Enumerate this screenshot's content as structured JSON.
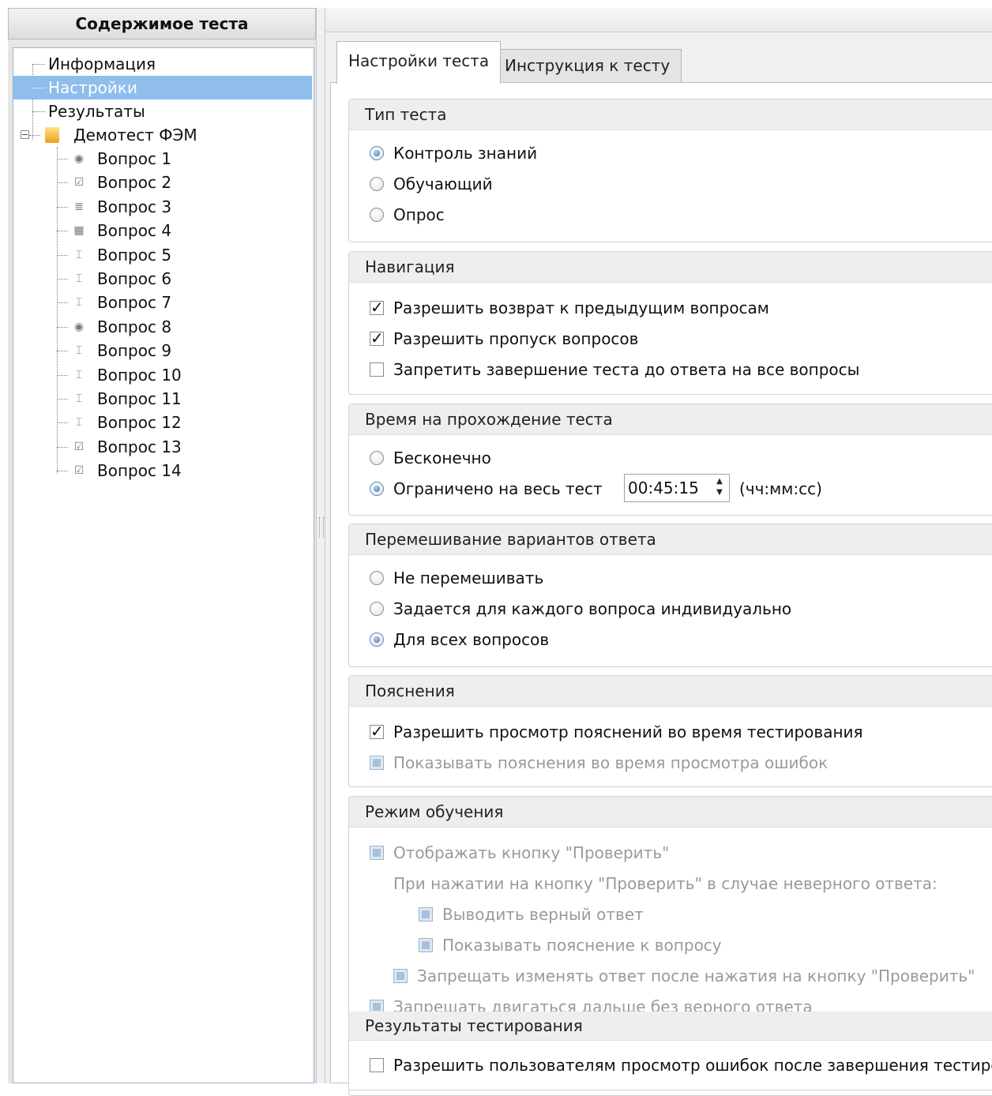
{
  "left_panel": {
    "title": "Содержимое теста",
    "tree": {
      "info": "Информация",
      "settings": "Настройки",
      "results": "Результаты",
      "folder": "Демотест ФЭМ",
      "questions": [
        {
          "label": "Вопрос 1",
          "icon": "radio-question-icon",
          "glyph": "◉"
        },
        {
          "label": "Вопрос 2",
          "icon": "checkbox-question-icon",
          "glyph": "☑"
        },
        {
          "label": "Вопрос 3",
          "icon": "ordering-question-icon",
          "glyph": "≣"
        },
        {
          "label": "Вопрос 4",
          "icon": "matching-question-icon",
          "glyph": "▦"
        },
        {
          "label": "Вопрос 5",
          "icon": "text-input-question-icon",
          "glyph": "⌶"
        },
        {
          "label": "Вопрос 6",
          "icon": "text-input-question-icon",
          "glyph": "⌶"
        },
        {
          "label": "Вопрос 7",
          "icon": "text-input-question-icon",
          "glyph": "⌶"
        },
        {
          "label": "Вопрос 8",
          "icon": "radio-question-icon",
          "glyph": "◉"
        },
        {
          "label": "Вопрос 9",
          "icon": "text-input-question-icon",
          "glyph": "⌶"
        },
        {
          "label": "Вопрос 10",
          "icon": "text-input-question-icon",
          "glyph": "⌶"
        },
        {
          "label": "Вопрос 11",
          "icon": "text-input-question-icon",
          "glyph": "⌶"
        },
        {
          "label": "Вопрос 12",
          "icon": "text-input-question-icon",
          "glyph": "⌶"
        },
        {
          "label": "Вопрос 13",
          "icon": "checkbox-question-icon",
          "glyph": "☑"
        },
        {
          "label": "Вопрос 14",
          "icon": "checkbox-question-icon",
          "glyph": "☑"
        }
      ]
    }
  },
  "tabs": [
    "Настройки теста",
    "Инструкция к тесту"
  ],
  "active_tab": "Настройки теста",
  "groups": {
    "test_type": {
      "title": "Тип теста",
      "options": [
        {
          "label": "Контроль знаний",
          "checked": true
        },
        {
          "label": "Обучающий",
          "checked": false
        },
        {
          "label": "Опрос",
          "checked": false
        }
      ]
    },
    "navigation": {
      "title": "Навигация",
      "options": [
        {
          "label": "Разрешить возврат к предыдущим вопросам",
          "checked": true
        },
        {
          "label": "Разрешить пропуск вопросов",
          "checked": true
        },
        {
          "label": "Запретить завершение теста до ответа на все вопросы",
          "checked": false
        }
      ]
    },
    "time": {
      "title": "Время на прохождение теста",
      "infinite": "Бесконечно",
      "limited": "Ограничено на весь тест",
      "value": "00:45:15",
      "unit": "(чч:мм:сс)",
      "selected": "limited"
    },
    "shuffle": {
      "title": "Перемешивание вариантов ответа",
      "options": [
        {
          "label": "Не перемешивать",
          "checked": false
        },
        {
          "label": "Задается для каждого вопроса индивидуально",
          "checked": false
        },
        {
          "label": "Для всех вопросов",
          "checked": true
        }
      ]
    },
    "explanations": {
      "title": "Пояснения",
      "allow_view": "Разрешить просмотр пояснений во время тестирования",
      "allow_view_checked": true,
      "show_on_review": "Показывать пояснения во время просмотра ошибок",
      "show_on_review_enabled": false
    },
    "learning": {
      "title": "Режим обучения",
      "show_check_button": "Отображать кнопку \"Проверить\"",
      "on_wrong_caption": "При нажатии на кнопку \"Проверить\" в случае неверного ответа:",
      "show_correct": "Выводить верный ответ",
      "show_explanation": "Показывать пояснение к вопросу",
      "forbid_change": "Запрещать изменять ответ после нажатия на кнопку \"Проверить\"",
      "forbid_continue": "Запрещать двигаться дальше без верного ответа"
    },
    "results": {
      "title": "Результаты тестирования",
      "allow_review": "Разрешить пользователям просмотр ошибок после завершения тестирова",
      "allow_review_checked": false
    }
  },
  "colors": {
    "selection": "#8fbdec",
    "tree_border": "#9cb2cc",
    "radio_accent": "#3a6ea8",
    "disabled_text": "#9a9a9a"
  }
}
